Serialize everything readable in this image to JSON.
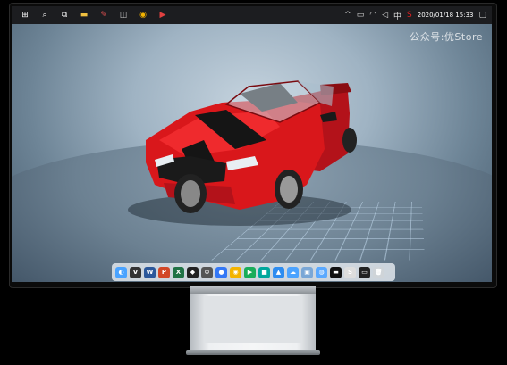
{
  "taskbar": {
    "clock": "2020/01/18 15:33",
    "left_icons": [
      "windows-logo-icon",
      "search-icon",
      "task-view-icon",
      "file-explorer-icon",
      "app-icon-1",
      "app-icon-2",
      "chrome-icon",
      "media-icon"
    ],
    "tray_icons": [
      "up-arrow-icon",
      "display-icon",
      "wifi-icon",
      "volume-icon",
      "ime-icon",
      "s-app-icon"
    ]
  },
  "watermark": "公众号:优Store",
  "dock": {
    "apps": [
      {
        "name": "finder",
        "glyph": "◐",
        "color": "#4aa3ff"
      },
      {
        "name": "app-v",
        "glyph": "V",
        "color": "#333"
      },
      {
        "name": "word",
        "glyph": "W",
        "color": "#2b579a"
      },
      {
        "name": "powerpoint",
        "glyph": "P",
        "color": "#d24726"
      },
      {
        "name": "excel",
        "glyph": "X",
        "color": "#217346"
      },
      {
        "name": "app-dark",
        "glyph": "◆",
        "color": "#222"
      },
      {
        "name": "app-settings",
        "glyph": "⚙",
        "color": "#555"
      },
      {
        "name": "app-circle",
        "glyph": "●",
        "color": "#3478f6"
      },
      {
        "name": "chrome",
        "glyph": "◉",
        "color": "#f4b400"
      },
      {
        "name": "app-green",
        "glyph": "▶",
        "color": "#1aad5a"
      },
      {
        "name": "app-teal",
        "glyph": "■",
        "color": "#00a79d"
      },
      {
        "name": "app-blue",
        "glyph": "▲",
        "color": "#2d8cf0"
      },
      {
        "name": "app-cloud",
        "glyph": "☁",
        "color": "#4ba3ff"
      },
      {
        "name": "preview",
        "glyph": "▣",
        "color": "#7aa7d6"
      },
      {
        "name": "app-drop",
        "glyph": "◍",
        "color": "#5aa9ff"
      },
      {
        "name": "app-terminal",
        "glyph": "▬",
        "color": "#111"
      },
      {
        "name": "app-ssg",
        "glyph": "S",
        "color": "#ddd"
      },
      {
        "name": "app-monitor",
        "glyph": "▭",
        "color": "#222"
      },
      {
        "name": "trash",
        "glyph": "🗑",
        "color": "#cfd4d8"
      }
    ]
  },
  "colors": {
    "car_body": "#d9171b",
    "stripe": "#1a1a1a"
  }
}
